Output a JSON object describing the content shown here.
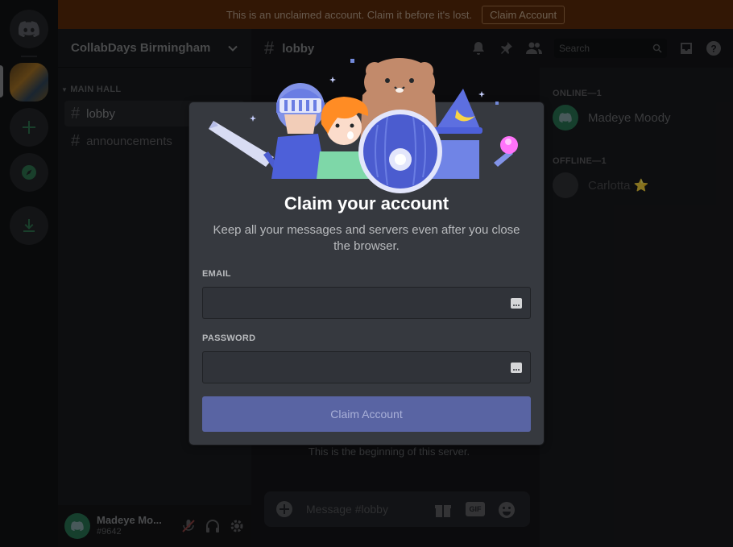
{
  "banner": {
    "message": "This is an unclaimed account. Claim it before it's lost.",
    "button_label": "Claim Account"
  },
  "server": {
    "name": "CollabDays Birmingham",
    "category": "MAIN HALL",
    "channels": [
      {
        "name": "lobby",
        "active": true
      },
      {
        "name": "announcements",
        "active": false
      }
    ]
  },
  "chat": {
    "channel_name": "lobby",
    "search_placeholder": "Search",
    "begin_text": "This is the beginning of this server.",
    "composer_placeholder": "Message #lobby",
    "gif_label": "GIF"
  },
  "user": {
    "name": "Madeye Mo...",
    "discriminator": "#9642"
  },
  "members": {
    "online_header": "ONLINE—1",
    "online": [
      {
        "name": "Madeye Moody"
      }
    ],
    "offline_header": "OFFLINE—1",
    "offline": [
      {
        "name": "Carlotta ⭐"
      }
    ]
  },
  "modal": {
    "title": "Claim your account",
    "subtitle": "Keep all your messages and servers even after you close the browser.",
    "email_label": "EMAIL",
    "email_value": "",
    "password_label": "PASSWORD",
    "password_value": "",
    "submit_label": "Claim Account"
  },
  "colors": {
    "blurple_muted": "#5964a3",
    "modal_bg": "#36393f",
    "banner_bg": "#3b1c07"
  }
}
